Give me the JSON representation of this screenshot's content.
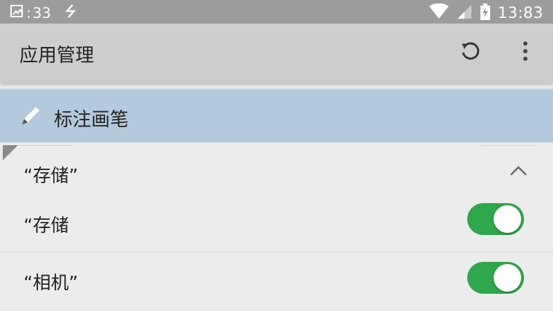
{
  "status_bar": {
    "notification_count": "33",
    "time": "13:83"
  },
  "app_bar": {
    "title": "应用管理"
  },
  "annotation": {
    "label": "标注画笔"
  },
  "section": {
    "title": "“存储”",
    "rows": [
      {
        "label": "“存储",
        "enabled": true
      },
      {
        "label": "“相机”",
        "enabled": true
      }
    ]
  },
  "colors": {
    "status_bar": "#9c9c9c",
    "app_bar": "#cdcdcd",
    "highlight_row": "#b3c9dc",
    "toggle_on": "#2ea84a",
    "background": "#ebebeb"
  }
}
